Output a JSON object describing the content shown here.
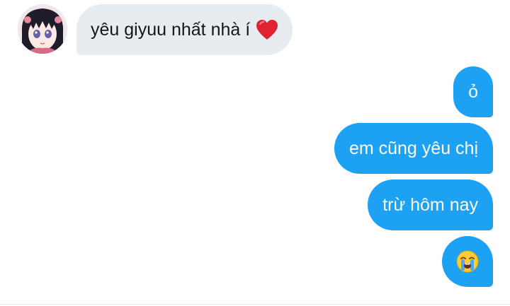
{
  "messages": [
    {
      "sender": "contact",
      "text": "yêu giyuu nhất nhà í",
      "emoji_icon": "red-heart-icon"
    },
    {
      "sender": "self",
      "text": "ỏ"
    },
    {
      "sender": "self",
      "text": "em cũng yêu chị"
    },
    {
      "sender": "self",
      "text": "trừ hôm nay"
    },
    {
      "sender": "self",
      "text": "",
      "emoji_icon": "loudly-crying-face-icon"
    }
  ],
  "colors": {
    "received_bubble": "#e6ecf0",
    "received_text": "#14171a",
    "sent_bubble": "#1da1f2",
    "sent_text": "#ffffff",
    "heart": "#e0242f"
  }
}
